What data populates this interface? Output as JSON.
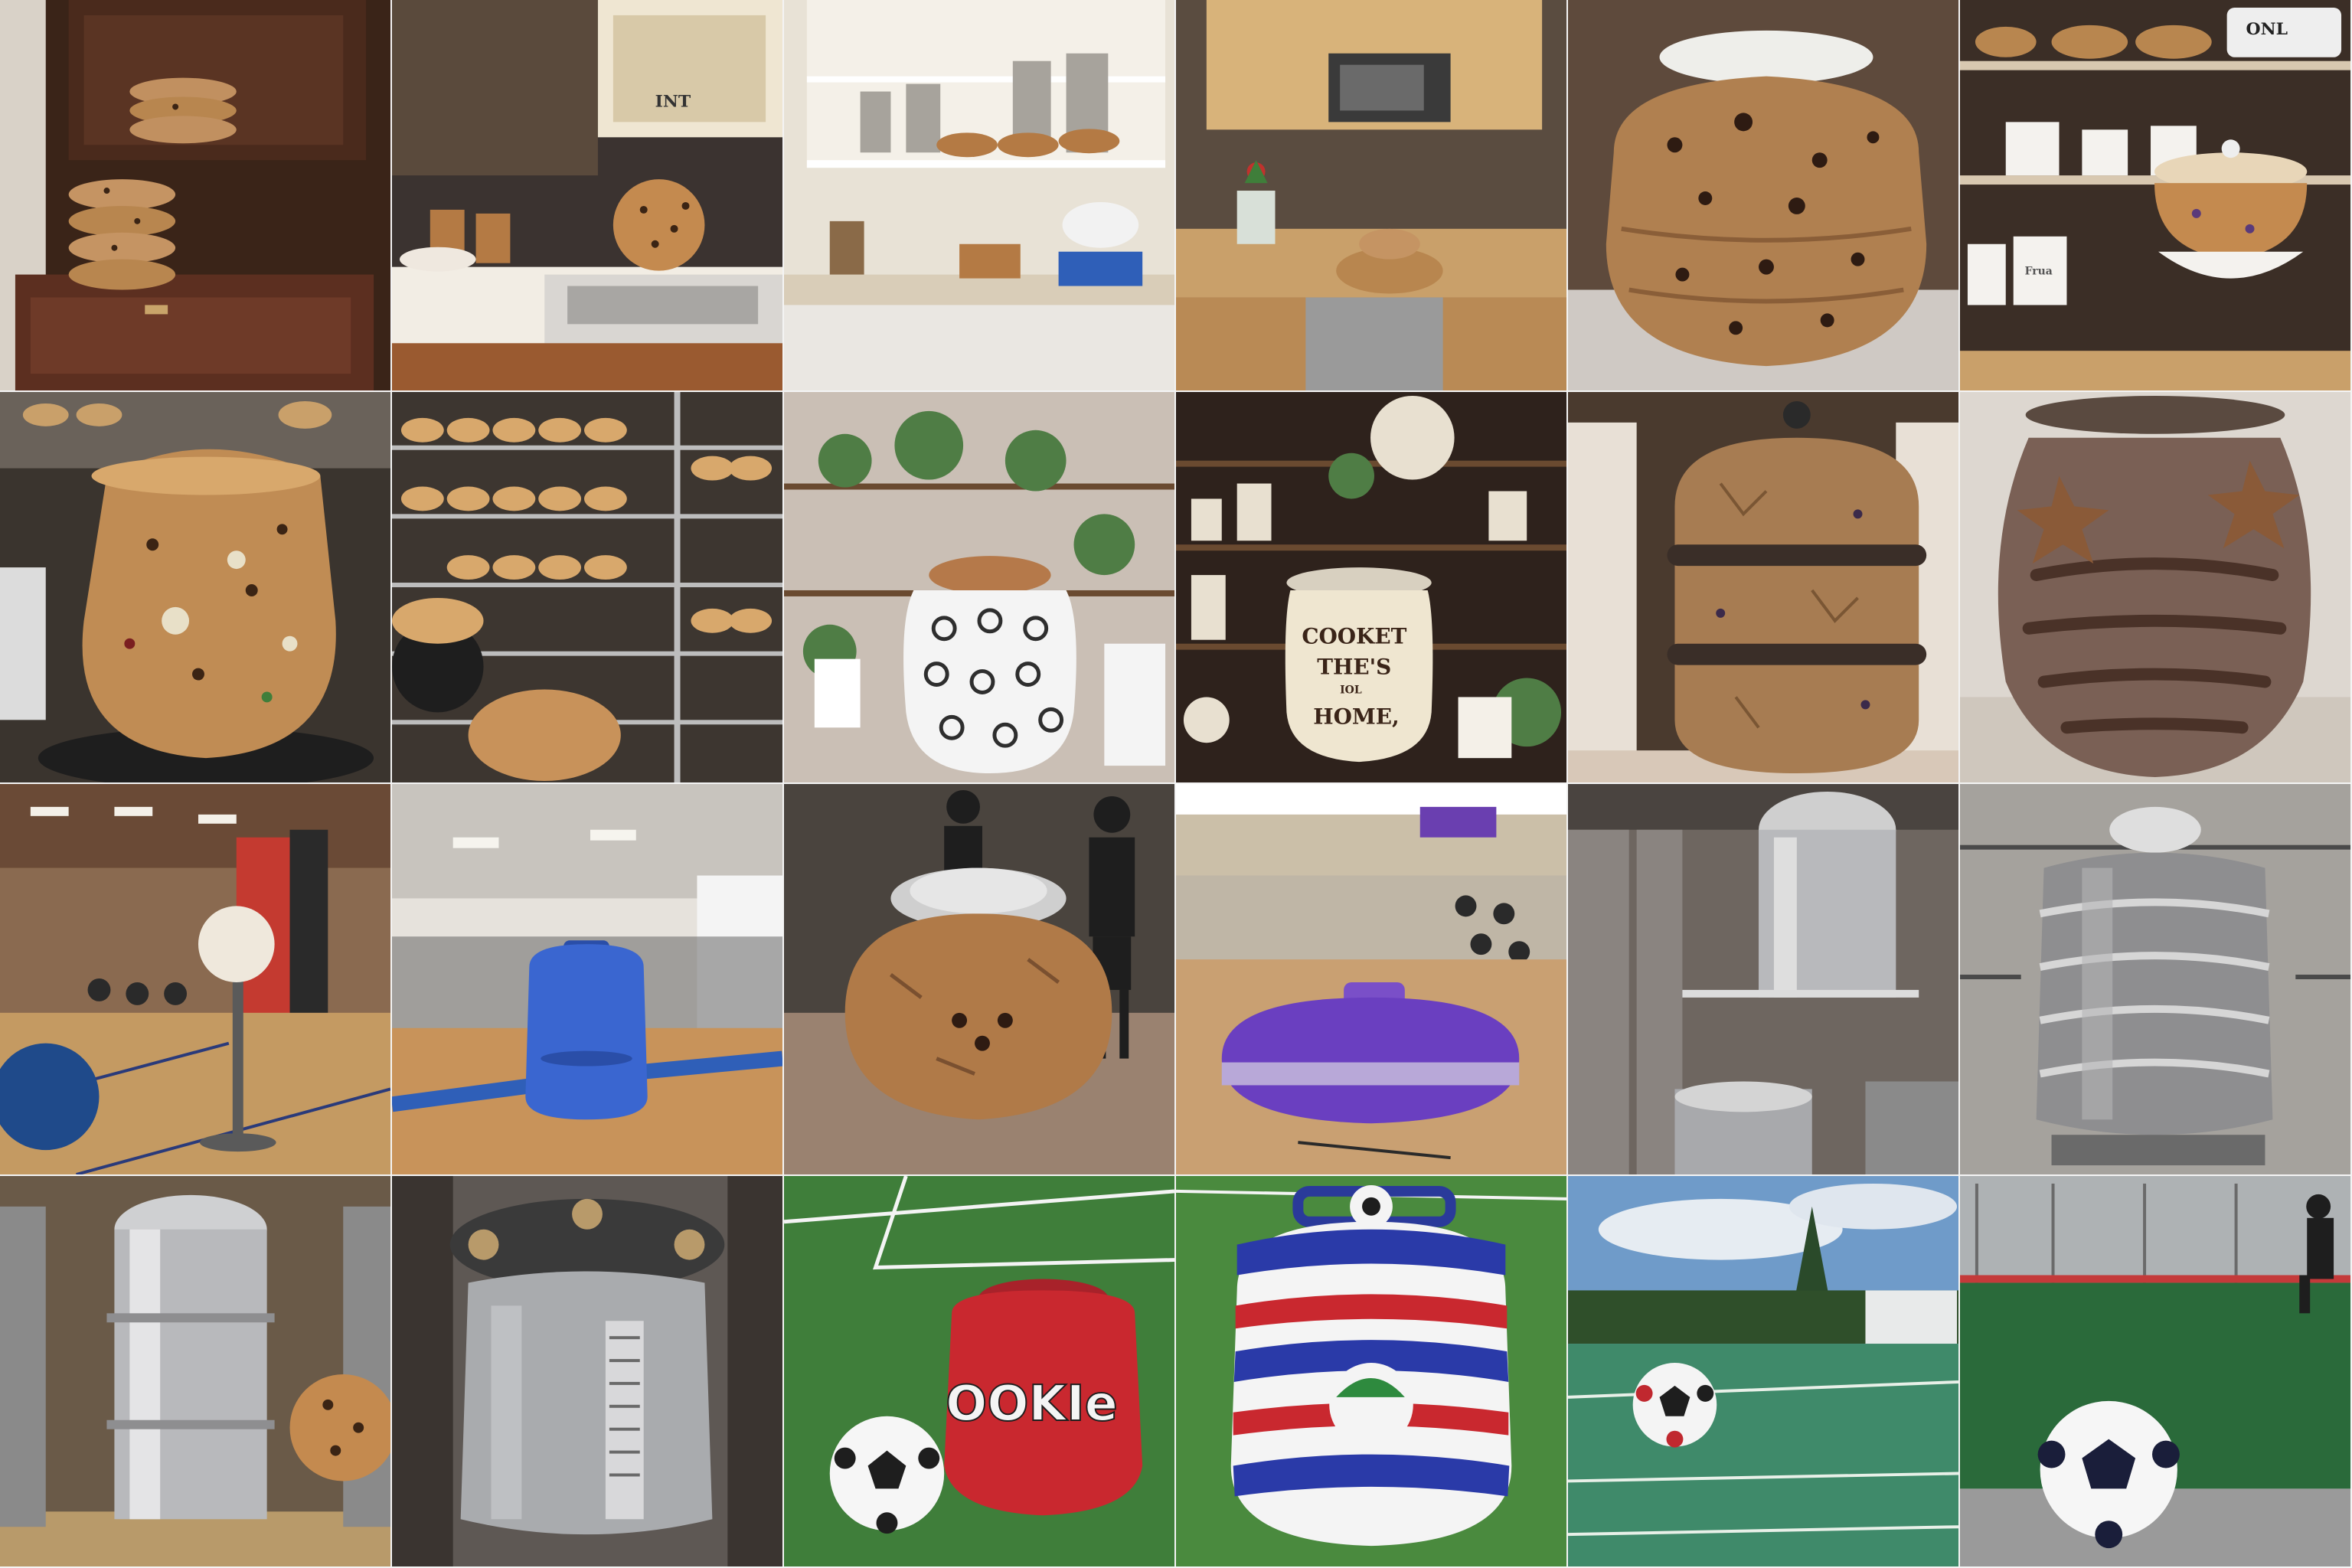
{
  "grid": {
    "rows": 4,
    "columns": 6
  },
  "texts": {
    "shelf_sign": "INT",
    "shelf_tag": "ONL",
    "jar_line_1": "COOKET",
    "jar_line_2": "THE'S",
    "jar_line_3": "HOME,",
    "jar_small": "IOL",
    "canister_label": "Frua",
    "red_jar_label": "OOKIe"
  },
  "colors": {
    "cookie": "#b98a55",
    "chip": "#3b2414",
    "wood_dark": "#4a2a1c",
    "grass": "#3f7e3a",
    "steel": "#b8b9bc",
    "gym_floor": "#c49a62"
  },
  "tiles": [
    {
      "id": "kitchen-cookie-stacks",
      "scene": "kitchen"
    },
    {
      "id": "kitchen-counter-cookie",
      "scene": "kitchen"
    },
    {
      "id": "pantry-shelves-jars",
      "scene": "kitchen"
    },
    {
      "id": "kitchen-microwave-cookies",
      "scene": "kitchen"
    },
    {
      "id": "giant-cookie-jar-closeup",
      "scene": "kitchen"
    },
    {
      "id": "shelf-cookie-canister",
      "scene": "kitchen"
    },
    {
      "id": "bakery-giant-cookie",
      "scene": "bakery"
    },
    {
      "id": "bakery-muffin-racks",
      "scene": "bakery"
    },
    {
      "id": "patterned-jar-plants",
      "scene": "shop"
    },
    {
      "id": "cookie-jar-home-sign",
      "scene": "shop"
    },
    {
      "id": "cookie-dough-jar-bands",
      "scene": "shop"
    },
    {
      "id": "ceramic-jar-star-cookies",
      "scene": "shop"
    },
    {
      "id": "gym-ball-stand",
      "scene": "gym"
    },
    {
      "id": "gym-blue-kettlebell",
      "scene": "gym"
    },
    {
      "id": "gym-cookie-jar-people",
      "scene": "gym"
    },
    {
      "id": "gym-purple-jar",
      "scene": "gym"
    },
    {
      "id": "factory-steel-tanks",
      "scene": "factory"
    },
    {
      "id": "factory-steel-drum",
      "scene": "factory"
    },
    {
      "id": "factory-tank-cookie",
      "scene": "factory"
    },
    {
      "id": "factory-steel-vessel",
      "scene": "factory"
    },
    {
      "id": "field-red-cookie-jar",
      "scene": "field"
    },
    {
      "id": "field-striped-jar",
      "scene": "field"
    },
    {
      "id": "field-soccer-ball-goal",
      "scene": "field"
    },
    {
      "id": "field-soccer-player-ball",
      "scene": "field"
    }
  ]
}
